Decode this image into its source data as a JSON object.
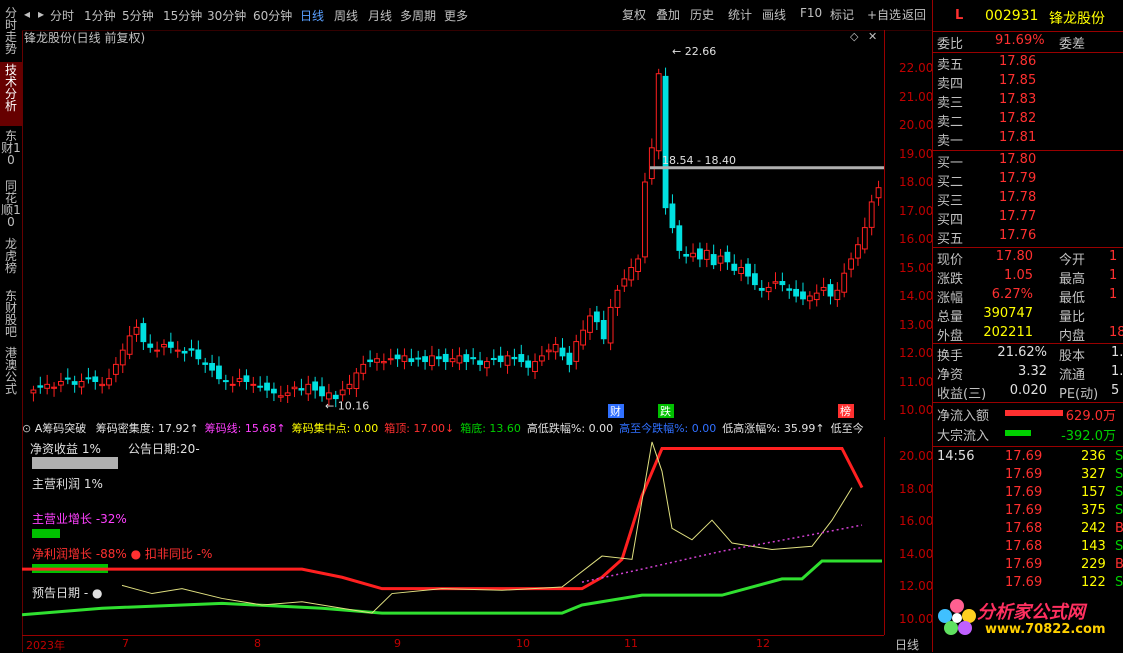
{
  "left_tabs": [
    {
      "label": "分时走势",
      "active": false
    },
    {
      "label": "技术分析",
      "active": true
    },
    {
      "label": "东财10",
      "active": false
    },
    {
      "label": "同花顺10",
      "active": false
    },
    {
      "label": "龙虎榜",
      "active": false
    },
    {
      "label": "东财股吧",
      "active": false
    },
    {
      "label": "港澳公式",
      "active": false
    }
  ],
  "toolbar": {
    "periods": [
      "分时",
      "1分钟",
      "5分钟",
      "15分钟",
      "30分钟",
      "60分钟",
      "日线",
      "周线",
      "月线",
      "多周期",
      "更多"
    ],
    "selected_period": "日线",
    "buttons": [
      "复权",
      "叠加",
      "历史",
      "统计",
      "画线",
      "F10",
      "标记",
      "+自选",
      "返回"
    ]
  },
  "chart": {
    "title": "锋龙股份(日线 前复权)",
    "price_ticks": [
      "22.00",
      "21.00",
      "20.00",
      "19.00",
      "18.00",
      "17.00",
      "16.00",
      "15.00",
      "14.00",
      "13.00",
      "12.00",
      "11.00",
      "10.00"
    ],
    "high_label": "22.66",
    "low_label": "10.16",
    "range_label": "18.54 - 18.40",
    "event_markers": [
      "财",
      "跌",
      "榜"
    ]
  },
  "indicator": {
    "name": "A筹码突破",
    "items": [
      {
        "text": "筹码密集度: 17.92↑",
        "color": "#e0e0e0"
      },
      {
        "text": "筹码线: 15.68↑",
        "color": "#ff40ff"
      },
      {
        "text": "筹码集中点: 0.00",
        "color": "#ffff00"
      },
      {
        "text": "箱顶: 17.00↓",
        "color": "#ff3030"
      },
      {
        "text": "箱底: 13.60",
        "color": "#00d000"
      },
      {
        "text": "高低跌幅%: 0.00",
        "color": "#e0e0e0"
      },
      {
        "text": "高至今跌幅%: 0.00",
        "color": "#3070ff"
      },
      {
        "text": "低高涨幅%: 35.99↑",
        "color": "#e0e0e0"
      },
      {
        "text": "低至今",
        "color": "#e0e0e0"
      }
    ],
    "ticks": [
      "20.00",
      "18.00",
      "16.00",
      "14.00",
      "12.00",
      "10.00"
    ],
    "labels": {
      "roe": "净资收益 1%",
      "announce": "公告日期:20-",
      "profit": "主营利润 1%",
      "revenue": "主营业增长 -32%",
      "netgrowth": "净利润增长 -88% ● 扣非同比 -%",
      "forecast": "预告日期 - ●"
    }
  },
  "date_axis": [
    "2023年",
    "7",
    "8",
    "9",
    "10",
    "11",
    "12"
  ],
  "date_axis_right": "日线",
  "quote": {
    "flag": "L",
    "code": "002931",
    "name": "锋龙股份",
    "weibi_label": "委比",
    "weibi": "91.69%",
    "weicha_label": "委差",
    "asks": [
      {
        "label": "卖五",
        "price": "17.86"
      },
      {
        "label": "卖四",
        "price": "17.85"
      },
      {
        "label": "卖三",
        "price": "17.83"
      },
      {
        "label": "卖二",
        "price": "17.82"
      },
      {
        "label": "卖一",
        "price": "17.81"
      }
    ],
    "bids": [
      {
        "label": "买一",
        "price": "17.80"
      },
      {
        "label": "买二",
        "price": "17.79"
      },
      {
        "label": "买三",
        "price": "17.78"
      },
      {
        "label": "买四",
        "price": "17.77"
      },
      {
        "label": "买五",
        "price": "17.76"
      }
    ],
    "stats": [
      {
        "label": "现价",
        "value": "17.80",
        "label2": "今开",
        "value2": "1",
        "color": "#ff3030"
      },
      {
        "label": "涨跌",
        "value": "1.05",
        "label2": "最高",
        "value2": "1",
        "color": "#ff3030"
      },
      {
        "label": "涨幅",
        "value": "6.27%",
        "label2": "最低",
        "value2": "1",
        "color": "#ff3030"
      },
      {
        "label": "总量",
        "value": "390747",
        "label2": "量比",
        "value2": "",
        "color": "#ffff00"
      },
      {
        "label": "外盘",
        "value": "202211",
        "label2": "内盘",
        "value2": "18",
        "color": "#ffff00"
      }
    ],
    "stats2": [
      {
        "label": "换手",
        "value": "21.62%",
        "label2": "股本",
        "value2": "1."
      },
      {
        "label": "净资",
        "value": "3.32",
        "label2": "流通",
        "value2": "1."
      },
      {
        "label": "收益(三)",
        "value": "0.020",
        "label2": "PE(动)",
        "value2": "5"
      }
    ],
    "flow": [
      {
        "label": "净流入额",
        "value": "629.0万",
        "color": "#ff3030"
      },
      {
        "label": "大宗流入",
        "value": "-392.0万",
        "color": "#00d000"
      }
    ],
    "ticks": [
      {
        "time": "14:56",
        "price": "17.69",
        "vol": "236",
        "dir": "S"
      },
      {
        "time": "",
        "price": "17.69",
        "vol": "327",
        "dir": "S"
      },
      {
        "time": "",
        "price": "17.69",
        "vol": "157",
        "dir": "S"
      },
      {
        "time": "",
        "price": "17.69",
        "vol": "375",
        "dir": "S"
      },
      {
        "time": "",
        "price": "17.68",
        "vol": "242",
        "dir": "B"
      },
      {
        "time": "",
        "price": "17.68",
        "vol": "143",
        "dir": "S"
      },
      {
        "time": "",
        "price": "17.69",
        "vol": "229",
        "dir": "B"
      },
      {
        "time": "",
        "price": "17.69",
        "vol": "122",
        "dir": "S"
      }
    ],
    "logo": {
      "text": "分析家公式网",
      "url": "www.70822.com"
    }
  }
}
